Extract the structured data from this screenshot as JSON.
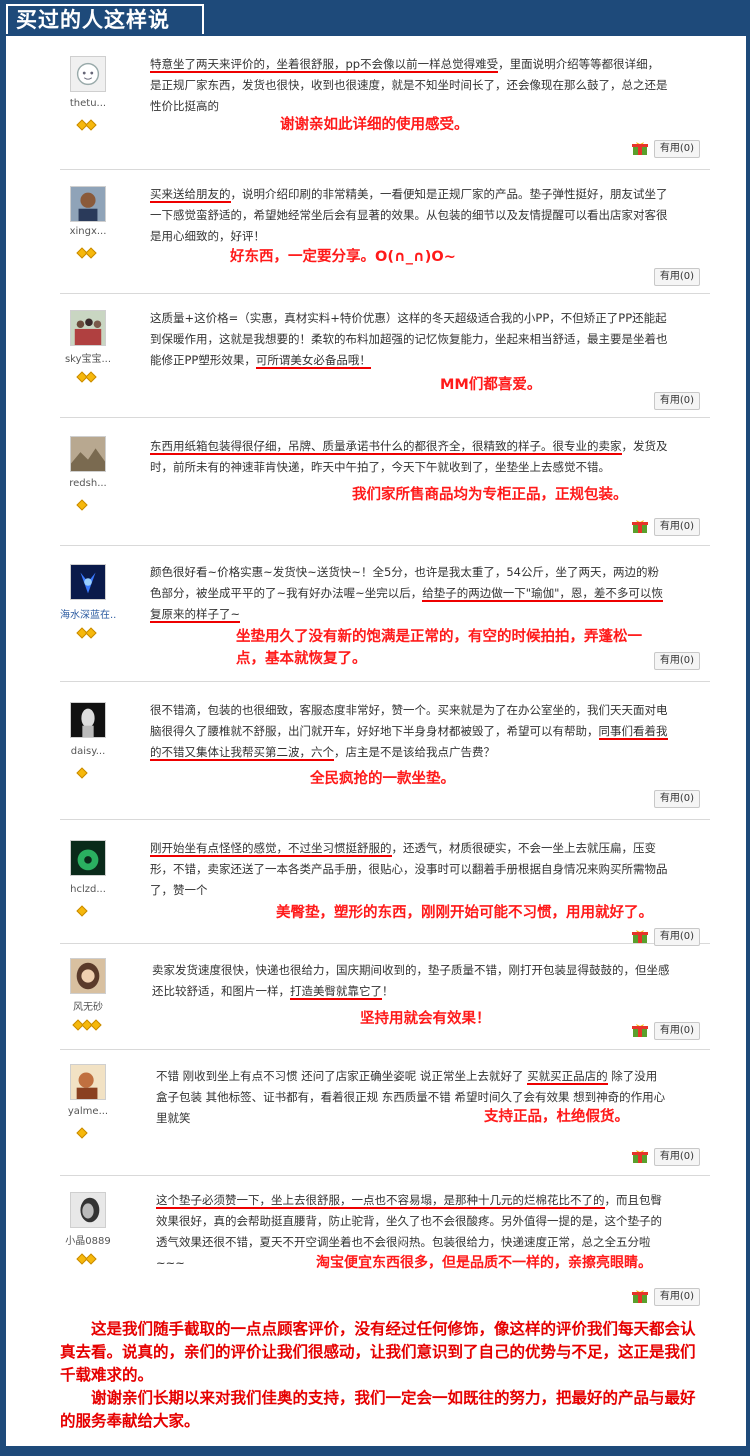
{
  "header": {
    "title": "买过的人这样说"
  },
  "useful_label": "有用(0)",
  "reviews": [
    {
      "user": "thetu...",
      "stars": 2,
      "text_pre": "",
      "text_ul": "特意坐了两天来评价的，坐着很舒服，pp不会像以前一样总觉得难受",
      "text_post": "，里面说明介绍等等都很详细，是正规厂家东西，发货也很快，收到也很速度，就是不知坐时间长了，还会像现在那么鼓了，总之还是性价比挺高的",
      "reply": "谢谢亲如此详细的使用感受。"
    },
    {
      "user": "xingx...",
      "stars": 2,
      "text_pre": "",
      "text_ul": "买来送给朋友的",
      "text_post": "，说明介绍印刷的非常精美，一看便知是正规厂家的产品。垫子弹性挺好，朋友试坐了一下感觉蛮舒适的，希望她经常坐后会有显著的效果。从包装的细节以及友情提醒可以看出店家对客很是用心细致的，好评！",
      "reply": "好东西，一定要分享。O(∩_∩)O~"
    },
    {
      "user": "sky宝宝...",
      "stars": 2,
      "text_pre": "这质量+这价格=（实惠，真材实料+特价优惠）这样的冬天超级适合我的小PP，不但矫正了PP还能起到保暖作用，这就是我想要的！柔软的布料加超强的记忆恢复能力，坐起来相当舒适，最主要是坐着也能修正PP塑形效果，",
      "text_ul": "可所谓美女必备品哦！",
      "text_post": "",
      "reply": "MM们都喜爱。"
    },
    {
      "user": "redsh...",
      "stars": 1,
      "text_pre": "",
      "text_ul": "东西用纸箱包装得很仔细，吊牌、质量承诺书什么的都很齐全，很精致的样子。很专业的卖家",
      "text_post": "，发货及时，前所未有的神速菲肯快递，昨天中午拍了，今天下午就收到了，坐垫坐上去感觉不错。",
      "reply": "我们家所售商品均为专柜正品，正规包装。"
    },
    {
      "user": "海水深蓝在...",
      "stars": 2,
      "text_pre": "颜色很好看~价格实惠~发货快~送货快~！全5分，也许是我太重了，54公斤，坐了两天，两边的粉色部分，被坐成平平的了~我有好办法喔~坐完以后，",
      "text_ul": "给垫子的两边做一下\"瑜伽\"，恩，差不多可以恢复原来的样子了~",
      "text_post": "",
      "reply": "坐垫用久了没有新的饱满是正常的，有空的时候拍拍，弄蓬松一点，基本就恢复了。"
    },
    {
      "user": "daisy...",
      "stars": 1,
      "text_pre": "很不错滴，包装的也很细致，客服态度非常好，赞一个。买来就是为了在办公室坐的，我们天天面对电脑很得久了腰椎就不舒服，出门就开车，好好地下半身身材都被毁了，希望可以有帮助，",
      "text_ul": "同事们看着我的不错又集体让我帮买第二波，六个",
      "text_post": "，店主是不是该给我点广告费？",
      "reply": "全民疯抢的一款坐垫。"
    },
    {
      "user": "hclzd...",
      "stars": 1,
      "text_pre": "",
      "text_ul": "刚开始坐有点怪怪的感觉，不过坐习惯挺舒服的",
      "text_post": "，还透气，材质很硬实，不会一坐上去就压扁，压变形，不错，卖家还送了一本各类产品手册，很贴心，没事时可以翻着手册根据自身情况来购买所需物品了，赞一个",
      "reply": "美臀垫，塑形的东西，刚刚开始可能不习惯，用用就好了。"
    },
    {
      "user": "风无砂",
      "stars": 3,
      "text_pre": "卖家发货速度很快，快递也很给力，国庆期间收到的，垫子质量不错，刚打开包装显得鼓鼓的，但坐感还比较舒适，和图片一样，",
      "text_ul": "打造美臀就靠它了",
      "text_post": "！",
      "reply": "坚持用就会有效果！"
    },
    {
      "user": "yalme...",
      "stars": 1,
      "text_pre": "不错 刚收到坐上有点不习惯 还问了店家正确坐姿呢 说正常坐上去就好了 ",
      "text_ul": "买就买正品店的",
      "text_post": " 除了没用盒子包装 其他标签、证书都有，看着很正规 东西质量不错 希望时间久了会有效果 想到神奇的作用心里就笑",
      "reply": "支持正品，杜绝假货。"
    },
    {
      "user": "小晶0889",
      "stars": 2,
      "text_pre": "",
      "text_ul": "这个垫子必须赞一下，坐上去很舒服，一点也不容易塌，是那种十几元的烂棉花比不了的",
      "text_post": "，而且包臀效果很好，真的会帮助挺直腰背，防止驼背，坐久了也不会很酸疼。另外值得一提的是，这个垫子的透气效果还很不错，夏天不开空调坐着也不会很闷热。包装很给力，快递速度正常，总之全五分啦~~~",
      "reply": "淘宝便宜东西很多，但是品质不一样的，亲擦亮眼睛。"
    }
  ],
  "closing": {
    "p1": "这是我们随手截取的一点点顾客评价，没有经过任何修饰，像这样的评价我们每天都会认真去看。说真的，亲们的评价让我们很感动，让我们意识到了自己的优势与不足，这正是我们千载难求的。",
    "p2": "谢谢亲们长期以来对我们佳奥的支持，我们一定会一如既往的努力，把最好的产品与最好的服务奉献给大家。"
  },
  "colors": {
    "frame": "#1e4a7a",
    "accent_red": "#ff1a1a",
    "star": "#f6b80c"
  }
}
